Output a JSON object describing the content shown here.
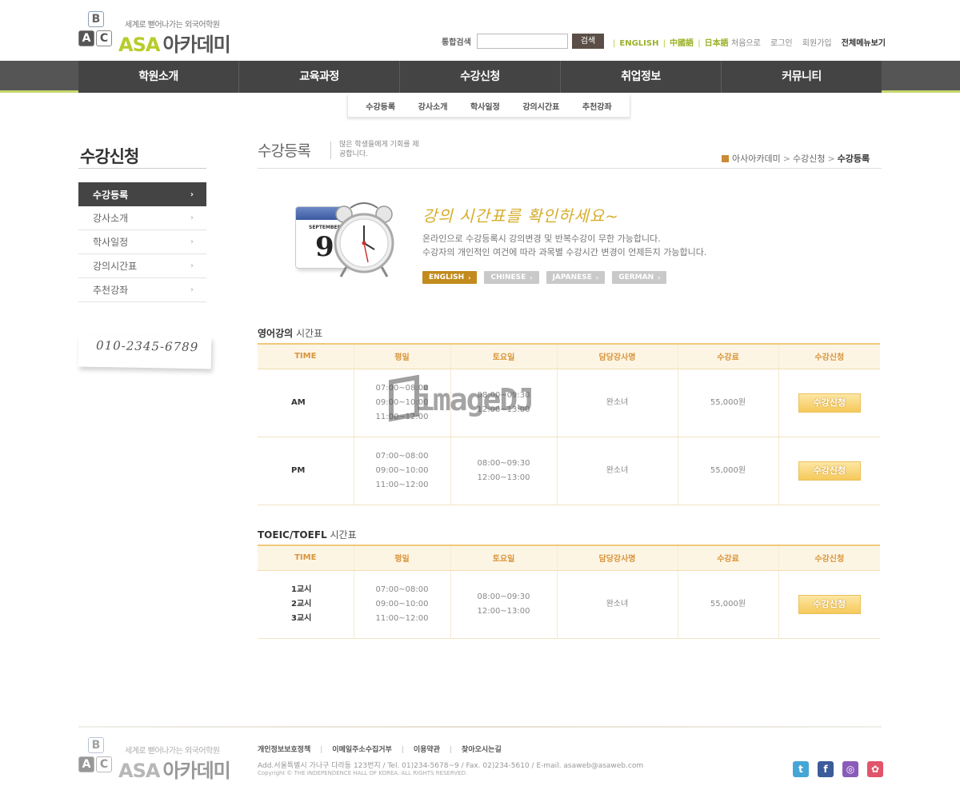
{
  "header": {
    "logo_tagline": "세계로 뻗어나가는 외국어학원",
    "logo_brand": "ASA",
    "logo_name": "아카데미",
    "logo_blocks": [
      "B",
      "A",
      "C"
    ],
    "search_label": "통합검색",
    "search_value": "",
    "search_button": "검색",
    "languages": [
      "ENGLISH",
      "中國語",
      "日本語"
    ],
    "util_links": [
      "처음으로",
      "로그인",
      "회원가입"
    ],
    "sitemap": "전체메뉴보기"
  },
  "gnb": [
    "학원소개",
    "교육과정",
    "수강신청",
    "취업정보",
    "커뮤니티"
  ],
  "submenu": [
    "수강등록",
    "강사소개",
    "학사일정",
    "강의시간표",
    "추천강좌"
  ],
  "sidebar": {
    "title": "수강신청",
    "items": [
      "수강등록",
      "강사소개",
      "학사일정",
      "강의시간표",
      "추천강좌"
    ],
    "phone": "010-2345-6789"
  },
  "content": {
    "title": "수강등록",
    "desc": "많은 학생들에게 기회를 제공합니다.",
    "breadcrumb": [
      "아사아카데미",
      "수강신청",
      "수강등록"
    ]
  },
  "promo": {
    "calendar_month": "SEPTEMBER",
    "calendar_day": "9",
    "title": "강의 시간표를 확인하세요~",
    "line1": "온라인으로 수강등록시 강의변경 및 반복수강이 무한 가능합니다.",
    "line2": "수강자의 개인적인 여건에 따라 과목별 수강시간 변경이 언제든지 가능합니다.",
    "lang_buttons": [
      "ENGLISH",
      "CHINESE",
      "JAPANESE",
      "GERMAN"
    ]
  },
  "english_table": {
    "title_bold": "영어강의",
    "title_rest": " 시간표",
    "headers": [
      "TIME",
      "평일",
      "토요일",
      "담당강사명",
      "수강료",
      "수강신청"
    ],
    "rows": [
      {
        "time": "AM",
        "weekday": [
          "07:00~08:00",
          "09:00~10:00",
          "11:00~12:00"
        ],
        "saturday": [
          "08:00~09:30",
          "12:00~13:00"
        ],
        "teacher": "완소녀",
        "fee": "55,000원",
        "apply": "수강신청"
      },
      {
        "time": "PM",
        "weekday": [
          "07:00~08:00",
          "09:00~10:00",
          "11:00~12:00"
        ],
        "saturday": [
          "08:00~09:30",
          "12:00~13:00"
        ],
        "teacher": "완소녀",
        "fee": "55,000원",
        "apply": "수강신청"
      }
    ]
  },
  "toeic_table": {
    "title_bold": "TOEIC/TOEFL",
    "title_rest": " 시간표",
    "headers": [
      "TIME",
      "평일",
      "토요일",
      "담당강사명",
      "수강료",
      "수강신청"
    ],
    "rows": [
      {
        "time": [
          "1교시",
          "2교시",
          "3교시"
        ],
        "weekday": [
          "07:00~08:00",
          "09:00~10:00",
          "11:00~12:00"
        ],
        "saturday": [
          "08:00~09:30",
          "12:00~13:00"
        ],
        "teacher": "완소녀",
        "fee": "55,000원",
        "apply": "수강신청"
      }
    ]
  },
  "watermark": "imageDJ",
  "footer": {
    "links": [
      "개인정보보호정책",
      "이메일주소수집거부",
      "이용약관",
      "찾아오시는길"
    ],
    "address": "Add.서울특별시 가나구 다라동 123번지  /  Tel. 01)234-5678~9  /  Fax. 02)234-5610  /  E-mail. asaweb@asaweb.com",
    "copyright": "Copyright © THE INDEPENDENCE HALL OF KOREA. ALL RIGHTS RESERVED.",
    "sns": [
      "twitter-icon",
      "facebook-icon",
      "podcast-icon",
      "blog-icon"
    ],
    "sns_colors": [
      "#45a6d6",
      "#3b5b9a",
      "#8a5bb8",
      "#e0556a"
    ],
    "sns_glyphs": [
      "t",
      "f",
      "◎",
      "✿"
    ]
  }
}
